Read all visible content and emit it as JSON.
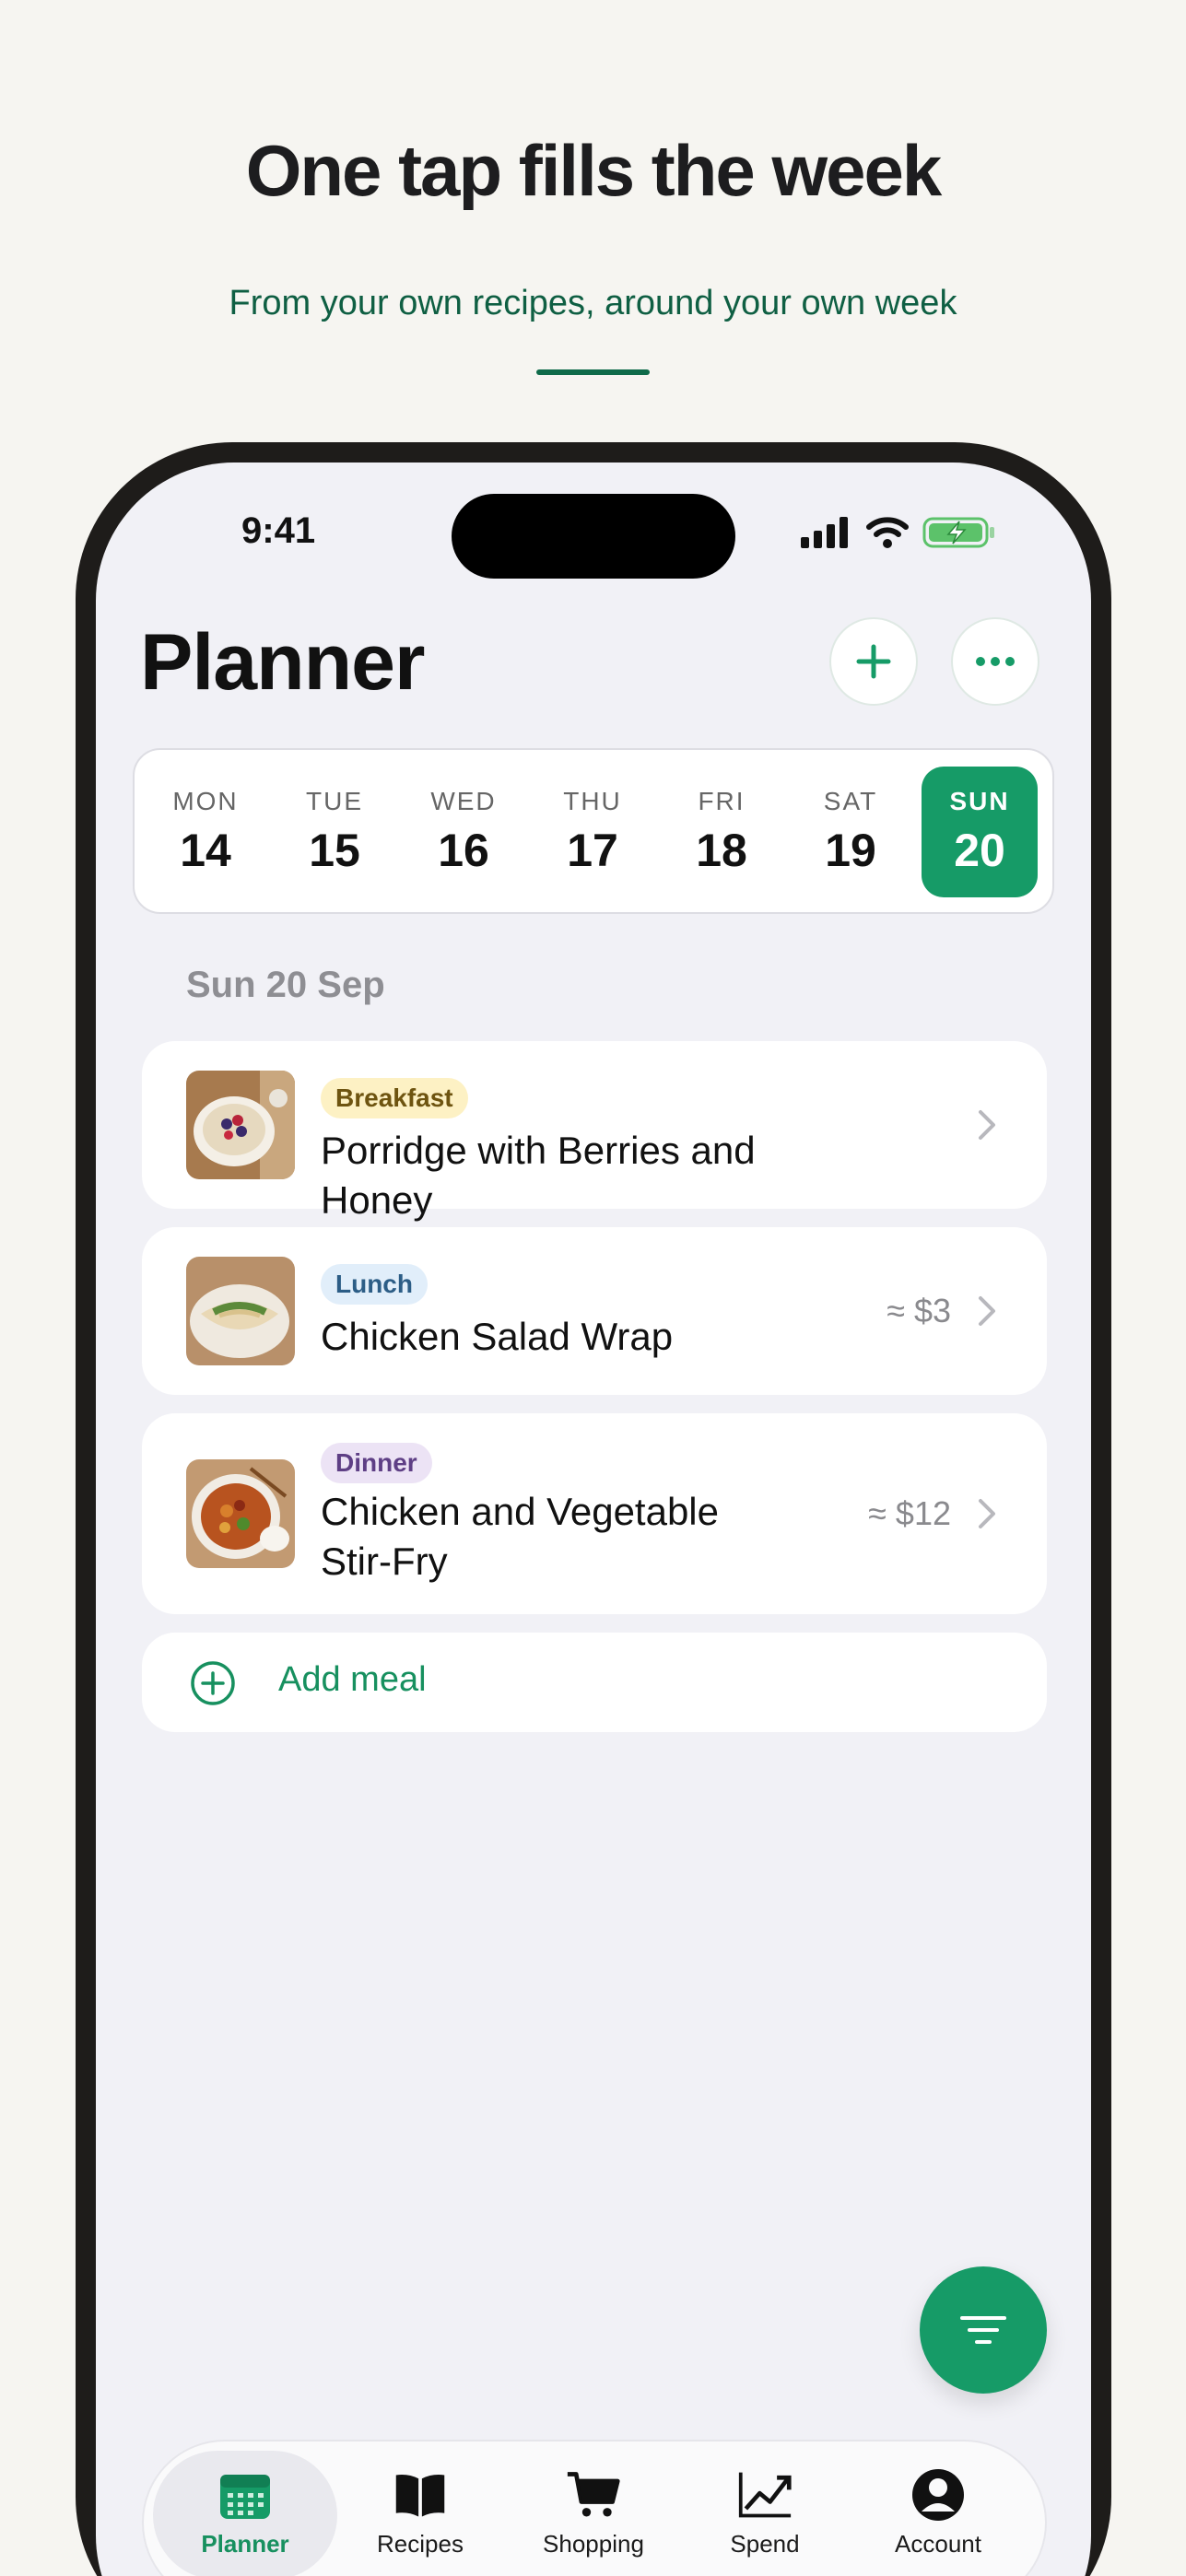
{
  "header": {
    "headline": "One tap fills the week",
    "subhead": "From your own recipes, around your own week"
  },
  "status_bar": {
    "time": "9:41"
  },
  "planner": {
    "title": "Planner",
    "days": [
      {
        "dow": "MON",
        "num": "14"
      },
      {
        "dow": "TUE",
        "num": "15"
      },
      {
        "dow": "WED",
        "num": "16"
      },
      {
        "dow": "THU",
        "num": "17"
      },
      {
        "dow": "FRI",
        "num": "18"
      },
      {
        "dow": "SAT",
        "num": "19"
      },
      {
        "dow": "SUN",
        "num": "20",
        "selected": true
      }
    ],
    "section_date": "Sun 20 Sep",
    "meals": [
      {
        "tag": "Breakfast",
        "name": "Porridge with Berries and Honey",
        "price": ""
      },
      {
        "tag": "Lunch",
        "name": "Chicken Salad Wrap",
        "price": "≈ $3"
      },
      {
        "tag": "Dinner",
        "name": "Chicken and Vegetable Stir-Fry",
        "price": "≈ $12"
      }
    ],
    "add_meal_label": "Add meal"
  },
  "tabbar": {
    "tabs": [
      {
        "label": "Planner",
        "icon": "calendar-icon",
        "active": true
      },
      {
        "label": "Recipes",
        "icon": "book-icon"
      },
      {
        "label": "Shopping",
        "icon": "cart-icon"
      },
      {
        "label": "Spend",
        "icon": "chart-icon"
      },
      {
        "label": "Account",
        "icon": "person-icon"
      }
    ]
  },
  "colors": {
    "accent": "#169b67",
    "accent_dark": "#0f5f43",
    "background": "#f6f5f1",
    "screen": "#f1f1f6"
  }
}
